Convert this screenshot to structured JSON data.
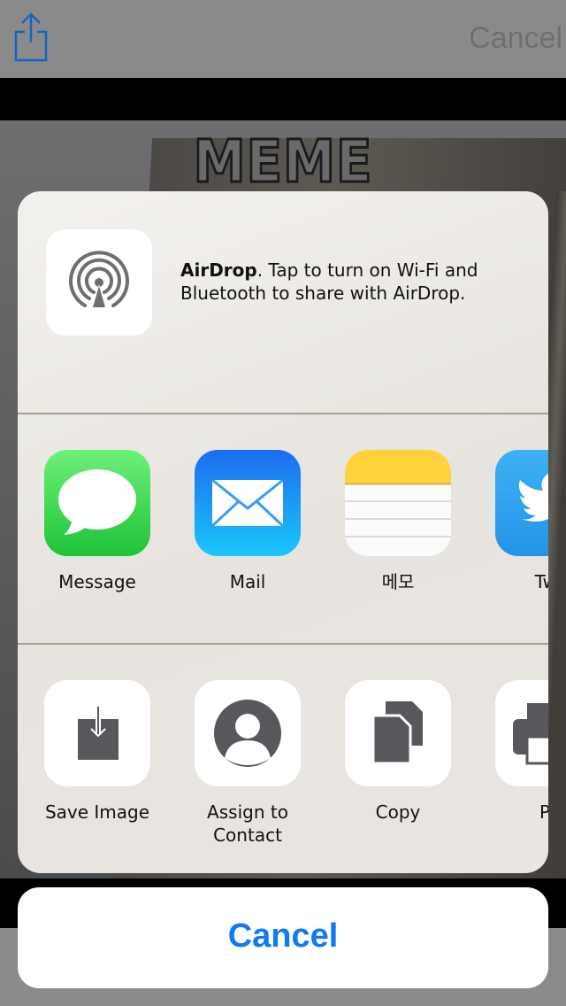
{
  "nav": {
    "cancel_label": "Cancel"
  },
  "photo": {
    "meme_text": "MEME"
  },
  "airdrop": {
    "title": "AirDrop",
    "description": ". Tap to turn on Wi-Fi and Bluetooth to share with AirDrop."
  },
  "apps": [
    {
      "label": "Message",
      "icon": "messages-icon",
      "color": "#2cc24a"
    },
    {
      "label": "Mail",
      "icon": "mail-icon",
      "color": "#1e7cf2"
    },
    {
      "label": "메모",
      "icon": "notes-icon",
      "color": "#fdd63a"
    },
    {
      "label": "Twi",
      "icon": "twitter-icon",
      "color": "#2ba2ef"
    }
  ],
  "actions": [
    {
      "label": "Save Image",
      "icon": "save-image-icon"
    },
    {
      "label": "Assign to Contact",
      "icon": "assign-contact-icon"
    },
    {
      "label": "Copy",
      "icon": "copy-icon"
    },
    {
      "label": "Pr",
      "icon": "print-icon"
    }
  ],
  "sheet": {
    "cancel_label": "Cancel"
  },
  "colors": {
    "accent": "#0e7af3",
    "separator": "#a89f94"
  }
}
